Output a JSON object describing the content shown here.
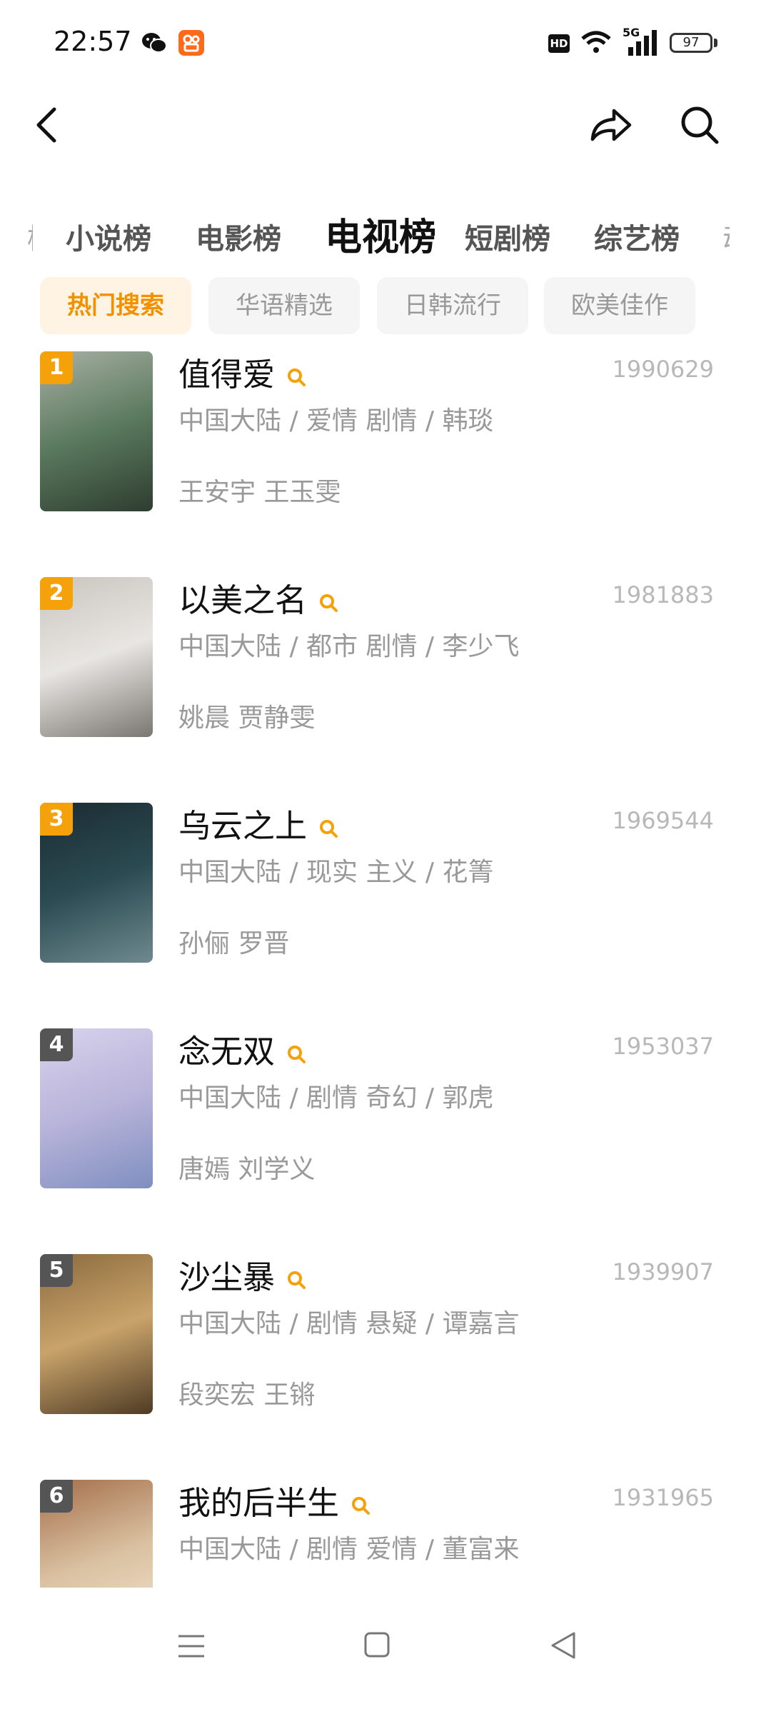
{
  "status_bar": {
    "time": "22:57",
    "hd": "HD",
    "network": "5G",
    "battery": "97"
  },
  "header": {
    "back_icon": "chevron-left-icon",
    "share_icon": "share-icon",
    "search_icon": "search-icon"
  },
  "category_tabs": [
    {
      "label": "小说榜",
      "active": false
    },
    {
      "label": "电影榜",
      "active": false
    },
    {
      "label": "电视榜",
      "active": true
    },
    {
      "label": "短剧榜",
      "active": false
    },
    {
      "label": "综艺榜",
      "active": false
    }
  ],
  "filter_chips": [
    {
      "label": "热门搜索",
      "active": true
    },
    {
      "label": "华语精选",
      "active": false
    },
    {
      "label": "日韩流行",
      "active": false
    },
    {
      "label": "欧美佳作",
      "active": false
    }
  ],
  "accent_color": "#f5a20a",
  "items": [
    {
      "rank": "1",
      "title": "值得爱",
      "score": "1990629",
      "meta": "中国大陆 / 爱情 剧情 / 韩琰",
      "cast": "王安宇 王玉雯",
      "poster_colors": [
        "#5b7a5e",
        "#a8b0a4",
        "#2e3d30"
      ]
    },
    {
      "rank": "2",
      "title": "以美之名",
      "score": "1981883",
      "meta": "中国大陆 / 都市 剧情 / 李少飞",
      "cast": "姚晨 贾静雯",
      "poster_colors": [
        "#e8e6e2",
        "#c9c5bf",
        "#7a7672"
      ]
    },
    {
      "rank": "3",
      "title": "乌云之上",
      "score": "1969544",
      "meta": "中国大陆 / 现实 主义 / 花箐",
      "cast": "孙俪 罗晋",
      "poster_colors": [
        "#2b4a52",
        "#1a2c31",
        "#6e8a8f"
      ]
    },
    {
      "rank": "4",
      "title": "念无双",
      "score": "1953037",
      "meta": "中国大陆 / 剧情 奇幻 / 郭虎",
      "cast": "唐嫣 刘学义",
      "poster_colors": [
        "#b9b4da",
        "#d8d3ec",
        "#7f8fc0"
      ]
    },
    {
      "rank": "5",
      "title": "沙尘暴",
      "score": "1939907",
      "meta": "中国大陆 / 剧情 悬疑 / 谭嘉言",
      "cast": "段奕宏 王锵",
      "poster_colors": [
        "#c9a36a",
        "#8a6a3e",
        "#4e3b25"
      ]
    },
    {
      "rank": "6",
      "title": "我的后半生",
      "score": "1931965",
      "meta": "中国大陆 / 剧情 爱情 / 董富来",
      "cast": "",
      "poster_colors": [
        "#d9c0a0",
        "#a46e4a",
        "#f3e6d2"
      ]
    }
  ],
  "nav_bar": {
    "menu_icon": "menu-icon",
    "home_icon": "square-home-icon",
    "back_icon": "triangle-back-icon"
  }
}
